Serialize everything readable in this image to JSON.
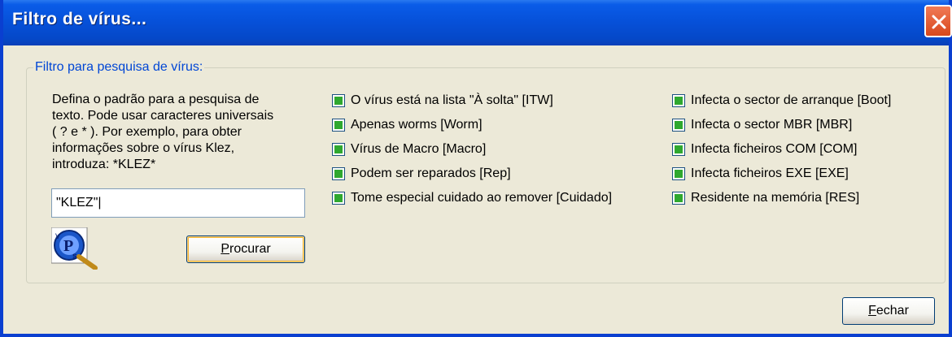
{
  "window": {
    "title": "Filtro de vírus..."
  },
  "group": {
    "legend": "Filtro para pesquisa de vírus:",
    "help_lines": [
      "Defina o padrão para a pesquisa de",
      "texto. Pode usar caracteres universais",
      "( ? e * ). Por exemplo, para obter",
      "informações sobre o vírus Klez,",
      "introduza: *KLEZ*"
    ],
    "search_value": "\"KLEZ\"|",
    "search_button": {
      "accel": "P",
      "rest": "rocurar"
    }
  },
  "filters_left": [
    {
      "label": "O vírus está na lista \"À solta\" [ITW]",
      "checked": true
    },
    {
      "label": "Apenas worms [Worm]",
      "checked": true
    },
    {
      "label": "Vírus de Macro [Macro]",
      "checked": true
    },
    {
      "label": "Podem ser reparados [Rep]",
      "checked": true
    },
    {
      "label": "Tome especial cuidado ao remover [Cuidado]",
      "checked": true
    }
  ],
  "filters_right": [
    {
      "label": "Infecta o sector de arranque [Boot]",
      "checked": true
    },
    {
      "label": "Infecta o sector MBR [MBR]",
      "checked": true
    },
    {
      "label": "Infecta ficheiros COM [COM]",
      "checked": true
    },
    {
      "label": "Infecta ficheiros EXE [EXE]",
      "checked": true
    },
    {
      "label": "Residente na memória [RES]",
      "checked": true
    }
  ],
  "close_button": {
    "accel": "F",
    "rest": "echar"
  },
  "colors": {
    "titlebar": "#0650d8",
    "checkbox_fill": "#2fa82f",
    "legend": "#0046d5"
  }
}
